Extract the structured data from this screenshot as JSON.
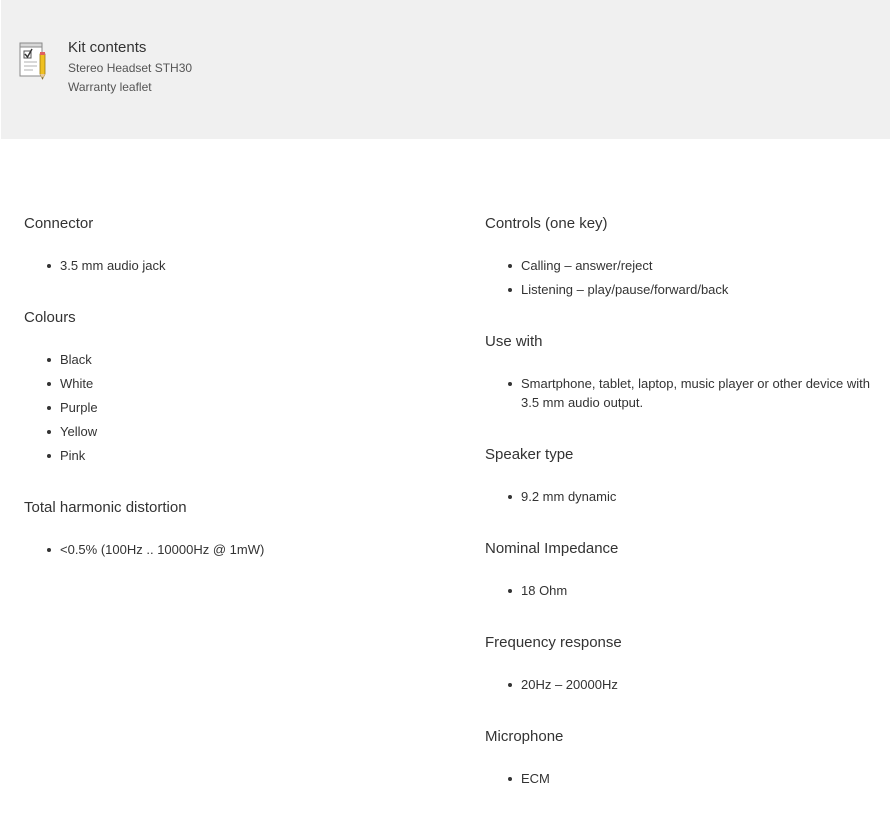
{
  "kit": {
    "icon": "checklist-pencil-icon",
    "title": "Kit contents",
    "items": [
      "Stereo Headset STH30",
      "Warranty leaflet"
    ]
  },
  "left_column": {
    "connector": {
      "heading": "Connector",
      "items": [
        "3.5 mm audio jack"
      ]
    },
    "colours": {
      "heading": "Colours",
      "items": [
        "Black",
        "White",
        "Purple",
        "Yellow",
        "Pink"
      ]
    },
    "thd": {
      "heading": "Total harmonic distortion",
      "items": [
        "<0.5% (100Hz .. 10000Hz @ 1mW)"
      ]
    }
  },
  "right_column": {
    "controls": {
      "heading": "Controls (one key)",
      "items": [
        "Calling – answer/reject",
        "Listening – play/pause/forward/back"
      ]
    },
    "use_with": {
      "heading": "Use with",
      "items": [
        "Smartphone, tablet, laptop, music player or other device with 3.5 mm audio output."
      ]
    },
    "speaker": {
      "heading": "Speaker type",
      "items": [
        "9.2 mm dynamic"
      ]
    },
    "impedance": {
      "heading": "Nominal Impedance",
      "items": [
        "18 Ohm"
      ]
    },
    "frequency": {
      "heading": "Frequency response",
      "items": [
        "20Hz – 20000Hz"
      ]
    },
    "microphone": {
      "heading": "Microphone",
      "items": [
        "ECM"
      ]
    }
  }
}
